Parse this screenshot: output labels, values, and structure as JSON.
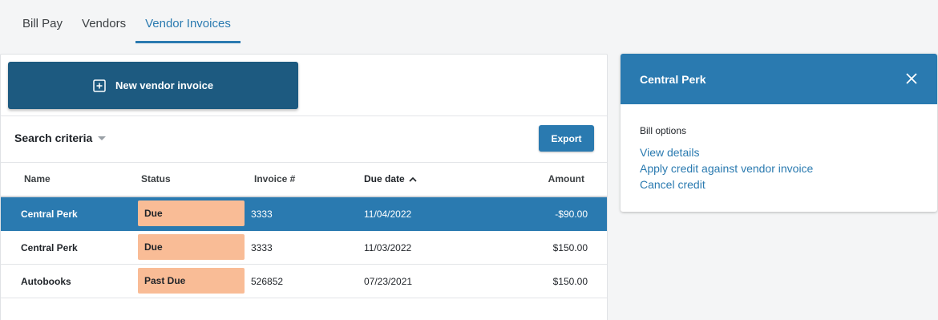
{
  "tabs": [
    {
      "label": "Bill Pay",
      "active": false
    },
    {
      "label": "Vendors",
      "active": false
    },
    {
      "label": "Vendor Invoices",
      "active": true
    }
  ],
  "toolbar": {
    "new_invoice_label": "New vendor invoice",
    "search_criteria_label": "Search criteria",
    "export_label": "Export"
  },
  "table": {
    "columns": {
      "name": "Name",
      "status": "Status",
      "invoice": "Invoice #",
      "due_date": "Due date",
      "amount": "Amount"
    },
    "sort": {
      "column": "Due date",
      "direction": "ascending"
    },
    "rows": [
      {
        "name": "Central Perk",
        "status": "Due",
        "invoice": "3333",
        "due_date": "11/04/2022",
        "amount": "-$90.00",
        "selected": true
      },
      {
        "name": "Central Perk",
        "status": "Due",
        "invoice": "3333",
        "due_date": "11/03/2022",
        "amount": "$150.00",
        "selected": false
      },
      {
        "name": "Autobooks",
        "status": "Past Due",
        "invoice": "526852",
        "due_date": "07/23/2021",
        "amount": "$150.00",
        "selected": false
      }
    ]
  },
  "side_panel": {
    "title": "Central Perk",
    "section_label": "Bill options",
    "links": [
      "View details",
      "Apply credit against vendor invoice",
      "Cancel credit"
    ]
  },
  "colors": {
    "primary": "#2a7ab0",
    "primary_dark": "#1d5a80",
    "status_badge": "#f9bc96"
  }
}
